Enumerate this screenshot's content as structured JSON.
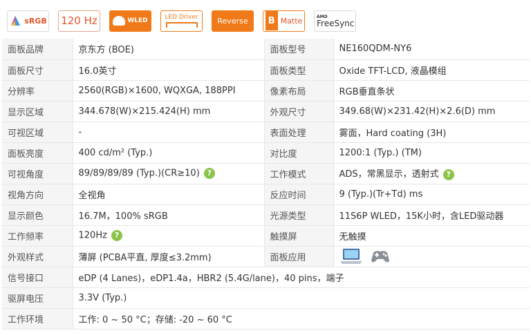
{
  "badges": {
    "srgb": "sRGB",
    "refresh": "120 Hz",
    "wled": "WLED",
    "led_driver": "LED Driver",
    "reverse": "Reverse",
    "matte_letter": "B",
    "matte": "Matte",
    "amd": "AMD",
    "freesync": "FreeSync"
  },
  "help_glyph": "?",
  "colors": {
    "accent": "#f07a19",
    "link": "#1a5aa5",
    "label_bg": "#f5f5f5",
    "help": "#8bc34a"
  },
  "specs": [
    {
      "l1": "面板品牌",
      "v1": "京东方 (BOE)",
      "l2": "面板型号",
      "v2": "NE160QDM-NY6"
    },
    {
      "l1": "面板尺寸",
      "v1": "16.0英寸",
      "l2": "面板类型",
      "v2": "Oxide TFT-LCD, 液晶模组"
    },
    {
      "l1": "分辨率",
      "v1": "2560(RGB)×1600, WQXGA, 188PPI",
      "l2": "像素布局",
      "v2": "RGB垂直条状"
    },
    {
      "l1": "显示区域",
      "v1": "344.678(W)×215.424(H) mm",
      "l2": "外观尺寸",
      "v2": "349.68(W)×231.42(H)×2.6(D) mm"
    },
    {
      "l1": "可视区域",
      "v1": "-",
      "l2": "表面处理",
      "v2": "雾面，Hard coating (3H)"
    },
    {
      "l1": "面板亮度",
      "v1": "400 cd/m² (Typ.)",
      "l2": "对比度",
      "v2": "1200:1 (Typ.) (TM)"
    },
    {
      "l1": "可视角度",
      "v1": "89/89/89/89 (Typ.)(CR≥10)",
      "l2": "工作模式",
      "v2": "ADS，常黑显示，透射式"
    },
    {
      "l1": "视角方向",
      "v1": "全视角",
      "l2": "反应时间",
      "v2": "9 (Typ.)(Tr+Td) ms"
    },
    {
      "l1": "显示颜色",
      "v1": "16.7M，100% sRGB",
      "l2": "光源类型",
      "v2": "11S6P WLED，15K小时，含LED驱动器"
    },
    {
      "l1": "工作频率",
      "v1": "120Hz",
      "l2": "触摸屏",
      "v2": "无触摸"
    },
    {
      "l1": "外观样式",
      "v1": "薄屏 (PCBA平直, 厚度≤3.2mm)",
      "l2": "面板应用",
      "v2": ""
    },
    {
      "l1": "信号接口",
      "v1": "eDP (4 Lanes)，eDP1.4a，HBR2 (5.4G/lane)，40 pins，端子"
    },
    {
      "l1": "驱屏电压",
      "v1": "3.3V (Typ.)"
    },
    {
      "l1": "工作环境",
      "v1": "工作: 0 ~ 50 °C；存储: -20 ~ 60 °C"
    }
  ],
  "app_icons": [
    "laptop-icon",
    "gamepad-icon"
  ]
}
